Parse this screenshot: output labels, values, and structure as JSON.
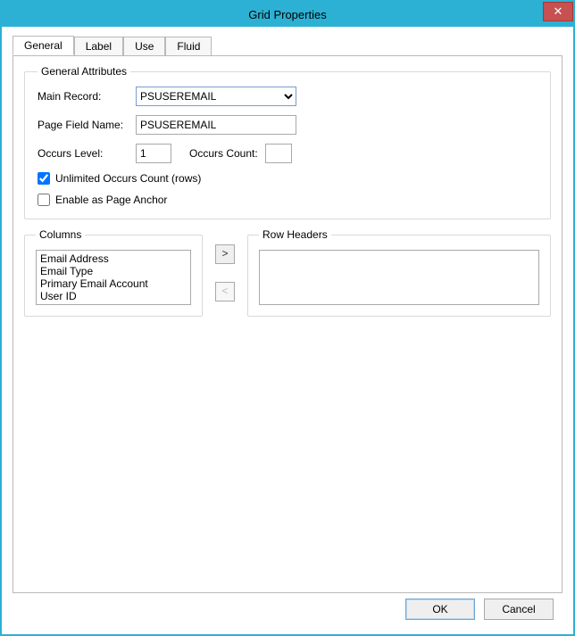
{
  "window": {
    "title": "Grid Properties"
  },
  "tabs": {
    "items": [
      "General",
      "Label",
      "Use",
      "Fluid"
    ],
    "active": 0
  },
  "general": {
    "legend": "General Attributes",
    "mainRecord": {
      "label": "Main Record:",
      "value": "PSUSEREMAIL"
    },
    "pageFieldName": {
      "label": "Page Field Name:",
      "value": "PSUSEREMAIL"
    },
    "occursLevel": {
      "label": "Occurs Level:",
      "value": "1"
    },
    "occursCount": {
      "label": "Occurs Count:",
      "value": ""
    },
    "unlimitedOccurs": {
      "label": "Unlimited Occurs Count (rows)",
      "checked": true
    },
    "enableAnchor": {
      "label": "Enable as Page Anchor",
      "checked": false
    }
  },
  "columns": {
    "legend": "Columns",
    "items": [
      "Email Address",
      "Email Type",
      "Primary Email Account",
      "User ID"
    ]
  },
  "rowHeaders": {
    "legend": "Row Headers",
    "items": []
  },
  "arrows": {
    "right": ">",
    "left": "<"
  },
  "footer": {
    "ok": "OK",
    "cancel": "Cancel"
  }
}
